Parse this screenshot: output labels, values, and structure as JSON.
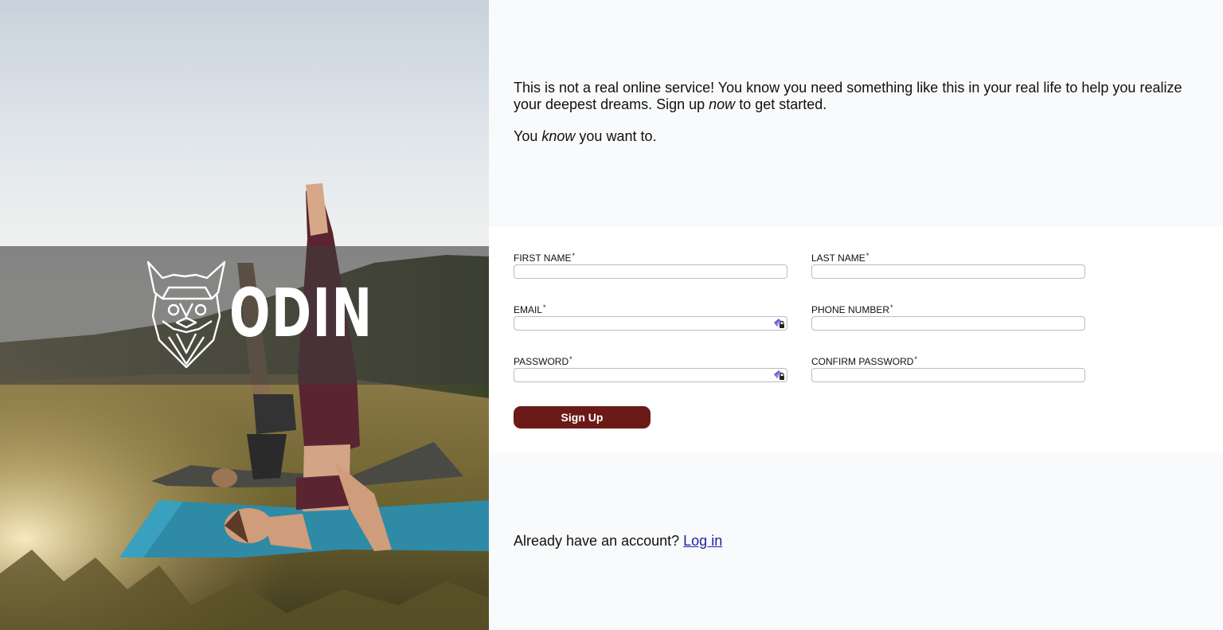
{
  "brand": {
    "name": "ODIN"
  },
  "intro": {
    "line1_before": "This is not a real online service! You know you need something like this in your real life to help you realize your deepest dreams. Sign up ",
    "line1_emph": "now",
    "line1_after": " to get started.",
    "line2_before": "You ",
    "line2_emph": "know",
    "line2_after": " you want to."
  },
  "form": {
    "required_marker": "*",
    "fields": {
      "first_name": {
        "label": "FIRST NAME",
        "value": ""
      },
      "last_name": {
        "label": "LAST NAME",
        "value": ""
      },
      "email": {
        "label": "EMAIL",
        "value": ""
      },
      "phone": {
        "label": "PHONE NUMBER",
        "value": ""
      },
      "password": {
        "label": "PASSWORD",
        "value": ""
      },
      "confirm_password": {
        "label": "CONFIRM PASSWORD",
        "value": ""
      }
    },
    "submit_label": "Sign Up"
  },
  "footer": {
    "prompt": "Already have an account? ",
    "login_label": "Log in"
  },
  "colors": {
    "button_bg": "#6b1a18",
    "link": "#1f1fa8",
    "panel_bg": "#ffffff",
    "page_bg": "#f9fafb"
  },
  "icons": {
    "field_icon": "password-manager-icon"
  }
}
